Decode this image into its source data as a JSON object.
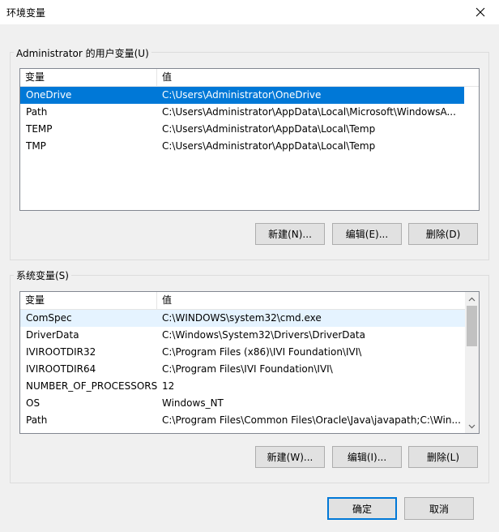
{
  "window": {
    "title": "环境变量"
  },
  "user_group": {
    "label": "Administrator 的用户变量(U)",
    "columns": [
      "变量",
      "值"
    ],
    "rows": [
      {
        "name": "OneDrive",
        "value": "C:\\Users\\Administrator\\OneDrive"
      },
      {
        "name": "Path",
        "value": "C:\\Users\\Administrator\\AppData\\Local\\Microsoft\\WindowsA..."
      },
      {
        "name": "TEMP",
        "value": "C:\\Users\\Administrator\\AppData\\Local\\Temp"
      },
      {
        "name": "TMP",
        "value": "C:\\Users\\Administrator\\AppData\\Local\\Temp"
      }
    ],
    "selected_row": "OneDrive",
    "buttons": {
      "new": "新建(N)...",
      "edit": "编辑(E)...",
      "delete": "删除(D)"
    }
  },
  "system_group": {
    "label": "系统变量(S)",
    "columns": [
      "变量",
      "值"
    ],
    "rows": [
      {
        "name": "ComSpec",
        "value": "C:\\WINDOWS\\system32\\cmd.exe"
      },
      {
        "name": "DriverData",
        "value": "C:\\Windows\\System32\\Drivers\\DriverData"
      },
      {
        "name": "IVIROOTDIR32",
        "value": "C:\\Program Files (x86)\\IVI Foundation\\IVI\\"
      },
      {
        "name": "IVIROOTDIR64",
        "value": "C:\\Program Files\\IVI Foundation\\IVI\\"
      },
      {
        "name": "NUMBER_OF_PROCESSORS",
        "value": "12"
      },
      {
        "name": "OS",
        "value": "Windows_NT"
      },
      {
        "name": "Path",
        "value": "C:\\Program Files\\Common Files\\Oracle\\Java\\javapath;C:\\Win..."
      }
    ],
    "hover_row": "ComSpec",
    "buttons": {
      "new": "新建(W)...",
      "edit": "编辑(I)...",
      "delete": "删除(L)"
    }
  },
  "footer": {
    "ok": "确定",
    "cancel": "取消"
  },
  "icons": {
    "close": "close-icon",
    "scroll_up": "chevron-up-icon",
    "scroll_down": "chevron-down-icon"
  },
  "colors": {
    "accent": "#0078d7",
    "hover": "#e5f3ff",
    "background": "#f0f0f0"
  }
}
